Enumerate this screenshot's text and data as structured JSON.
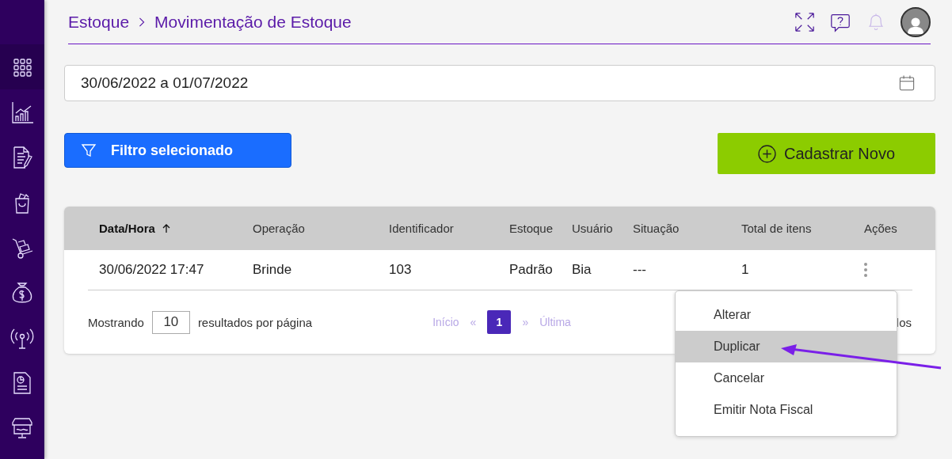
{
  "sidebar": {
    "items": [
      {
        "selected": true
      },
      {
        "selected": false
      },
      {
        "selected": false
      },
      {
        "selected": false
      },
      {
        "selected": false
      },
      {
        "selected": false
      },
      {
        "selected": false
      },
      {
        "selected": false
      },
      {
        "selected": false
      }
    ]
  },
  "header": {
    "breadcrumb": [
      "Estoque",
      "Movimentação de Estoque"
    ]
  },
  "date_range": {
    "value": "30/06/2022 a 01/07/2022"
  },
  "filter_button": {
    "label": "Filtro selecionado"
  },
  "new_button": {
    "label": "Cadastrar Novo"
  },
  "table": {
    "columns": [
      {
        "label": "Data/Hora",
        "sorted": true
      },
      {
        "label": "Operação",
        "sorted": false
      },
      {
        "label": "Identificador",
        "sorted": false
      },
      {
        "label": "Estoque",
        "sorted": false
      },
      {
        "label": "Usuário",
        "sorted": false
      },
      {
        "label": "Situação",
        "sorted": false
      },
      {
        "label": "Total de itens",
        "sorted": false
      },
      {
        "label": "Ações",
        "sorted": false
      }
    ],
    "rows": [
      {
        "cells": [
          "30/06/2022 17:47",
          "Brinde",
          "103",
          "Padrão",
          "Bia",
          "---",
          "1"
        ]
      }
    ]
  },
  "footer": {
    "showing_label": "Mostrando",
    "page_size": "10",
    "per_page_label": "resultados por página",
    "pagination": [
      {
        "label": "Início",
        "disabled": true,
        "selected": false
      },
      {
        "label": "«",
        "disabled": true,
        "selected": false
      },
      {
        "label": "1",
        "disabled": false,
        "selected": true
      },
      {
        "label": "»",
        "disabled": true,
        "selected": false
      },
      {
        "label": "Última",
        "disabled": true,
        "selected": false
      }
    ],
    "right_text": "los"
  },
  "action_menu": {
    "items": [
      {
        "label": "Alterar",
        "selected": false
      },
      {
        "label": "Duplicar",
        "selected": true
      },
      {
        "label": "Cancelar",
        "selected": false
      },
      {
        "label": "Emitir Nota Fiscal",
        "selected": false
      }
    ]
  }
}
